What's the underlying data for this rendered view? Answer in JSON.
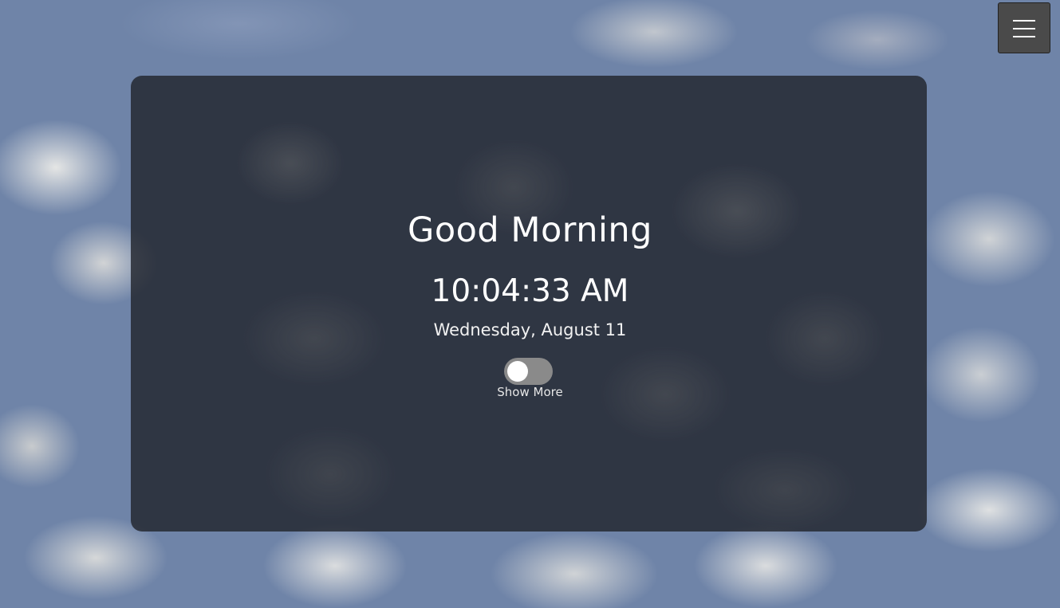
{
  "greeting": "Good Morning",
  "clock": {
    "time": "10:04:33 AM",
    "date": "Wednesday, August 11"
  },
  "show_more": {
    "label": "Show More",
    "enabled": false
  },
  "menu": {
    "icon": "hamburger-menu-icon"
  },
  "colors": {
    "card_background": "#1e2026",
    "toggle_track": "#8a8a8a",
    "toggle_knob": "#ffffff",
    "menu_button": "#4a4a4a",
    "text": "#ffffff"
  }
}
